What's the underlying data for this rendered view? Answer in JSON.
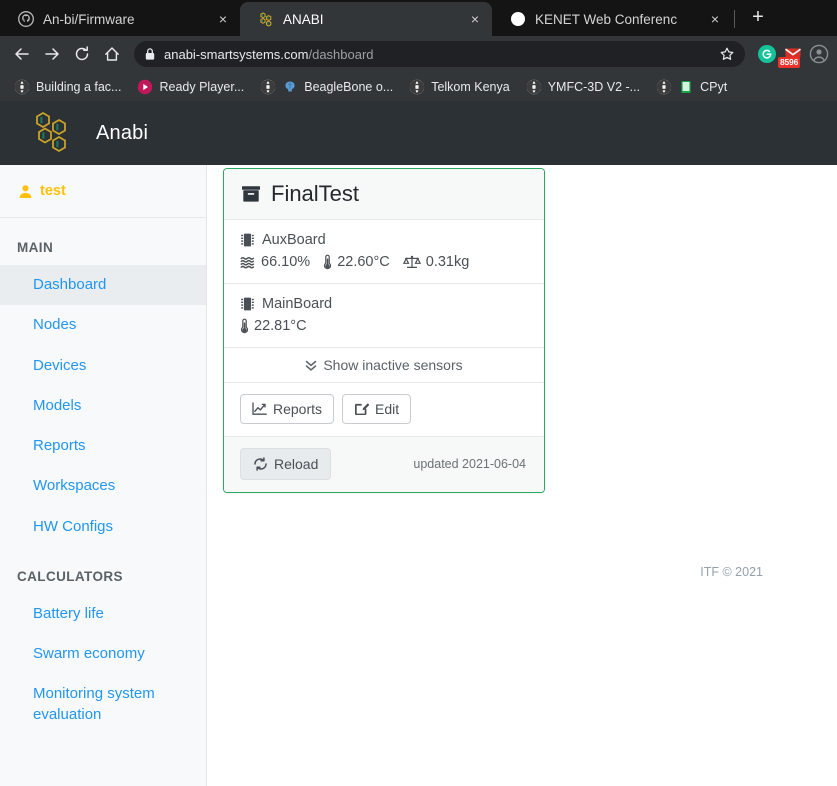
{
  "browser": {
    "tabs": [
      {
        "title": "An-bi/Firmware",
        "icon": "github-icon",
        "active": false,
        "close_label": "×"
      },
      {
        "title": "ANABI",
        "icon": "anabi-hex-icon",
        "active": true,
        "close_label": "×"
      },
      {
        "title": "KENET Web Conferenc",
        "icon": "kenet-icon",
        "active": false,
        "close_label": "×"
      }
    ],
    "new_tab_label": "+",
    "toolbar": {
      "back_icon": "back-arrow-icon",
      "forward_icon": "forward-arrow-icon",
      "reload_icon": "reload-icon",
      "home_icon": "home-icon",
      "lock_icon": "lock-icon",
      "url_host": "anabi-smartsystems.com",
      "url_path": "/dashboard",
      "star_icon": "bookmark-star-icon",
      "extensions": [
        {
          "name": "grammarly-extension-icon",
          "letter": "G"
        },
        {
          "name": "gmail-extension-icon",
          "badge": "8596"
        },
        {
          "name": "browser-profile-icon"
        }
      ]
    },
    "bookmarks": [
      {
        "label": "Building a fac...",
        "icon": "globe-icon"
      },
      {
        "label": "Ready Player...",
        "icon": "play-circle-icon"
      },
      {
        "label": "BeagleBone o...",
        "icon": "brain-icon",
        "leading_icon": "globe-icon"
      },
      {
        "label": "Telkom Kenya",
        "icon": "globe-icon"
      },
      {
        "label": "YMFC-3D V2 -...",
        "icon": "globe-icon"
      },
      {
        "label": "CPyt",
        "icon": "green-book-icon",
        "leading_icon": "globe-icon"
      }
    ]
  },
  "app": {
    "brand": "Anabi",
    "logo_icon": "honeycomb-logo-icon",
    "colors": {
      "header_bg": "#2c3136",
      "sidebar_bg": "#f8f9fa",
      "link": "#2196f3",
      "user_accent": "#ffc107",
      "card_border": "#2aa860"
    },
    "sidebar": {
      "user": {
        "name": "test",
        "icon": "user-icon"
      },
      "sections": [
        {
          "title": "MAIN",
          "items": [
            {
              "label": "Dashboard",
              "active": true
            },
            {
              "label": "Nodes",
              "active": false
            },
            {
              "label": "Devices",
              "active": false
            },
            {
              "label": "Models",
              "active": false
            },
            {
              "label": "Reports",
              "active": false
            },
            {
              "label": "Workspaces",
              "active": false
            },
            {
              "label": "HW Configs",
              "active": false
            }
          ]
        },
        {
          "title": "CALCULATORS",
          "items": [
            {
              "label": "Battery life",
              "active": false
            },
            {
              "label": "Swarm economy",
              "active": false
            },
            {
              "label": "Monitoring system evaluation",
              "active": false
            }
          ]
        }
      ]
    },
    "card": {
      "title": "FinalTest",
      "title_icon": "archive-box-icon",
      "boards": [
        {
          "name": "AuxBoard",
          "icon": "microchip-icon",
          "readings": [
            {
              "icon": "humidity-waves-icon",
              "value": "66.10%"
            },
            {
              "icon": "thermometer-icon",
              "value": "22.60°C"
            },
            {
              "icon": "balance-scale-icon",
              "value": "0.31kg"
            }
          ]
        },
        {
          "name": "MainBoard",
          "icon": "microchip-icon",
          "readings": [
            {
              "icon": "thermometer-icon",
              "value": "22.81°C"
            }
          ]
        }
      ],
      "toggle": {
        "label": "Show inactive sensors",
        "icon": "chevron-double-down-icon"
      },
      "actions": [
        {
          "label": "Reports",
          "icon": "chart-line-icon"
        },
        {
          "label": "Edit",
          "icon": "pencil-square-icon"
        }
      ],
      "reload": {
        "label": "Reload",
        "icon": "refresh-icon"
      },
      "updated": "updated 2021-06-04"
    },
    "footer": "ITF © 2021"
  }
}
